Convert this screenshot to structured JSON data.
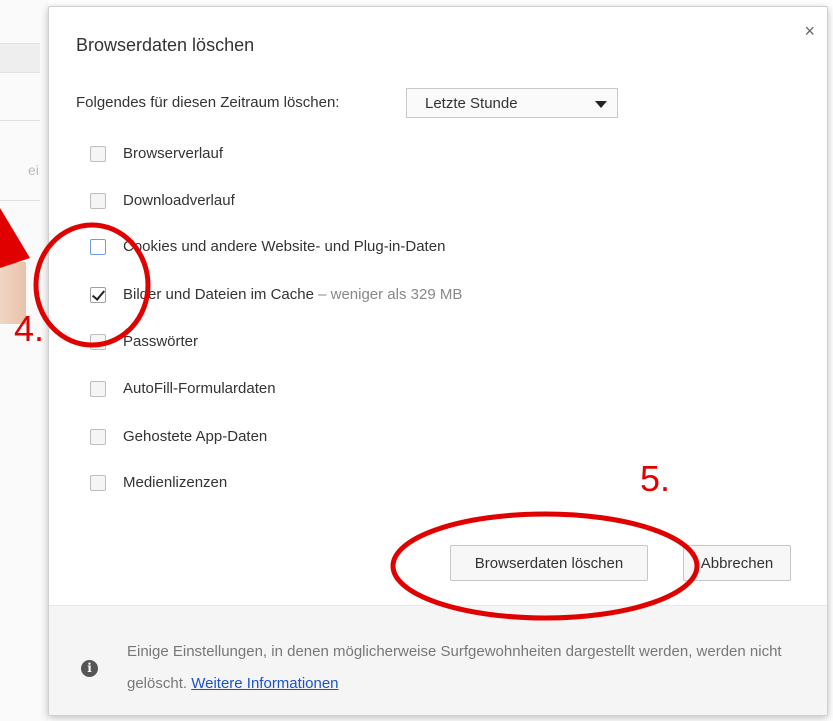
{
  "dialog": {
    "title": "Browserdaten löschen",
    "close_icon": "close-icon",
    "close_glyph": "×"
  },
  "time_range": {
    "label": "Folgendes für diesen Zeitraum löschen:",
    "selected": "Letzte Stunde"
  },
  "options": [
    {
      "label": "Browserverlauf",
      "checked": false
    },
    {
      "label": "Downloadverlauf",
      "checked": false
    },
    {
      "label": "Cookies und andere Website- und Plug-in-Daten",
      "checked": false
    },
    {
      "label": "Bilder und Dateien im Cache",
      "extra": " –  weniger als 329 MB",
      "checked": true
    },
    {
      "label": "Passwörter",
      "checked": false
    },
    {
      "label": "AutoFill-Formulardaten",
      "checked": false
    },
    {
      "label": "Gehostete App-Daten",
      "checked": false
    },
    {
      "label": "Medienlizenzen",
      "checked": false
    }
  ],
  "buttons": {
    "clear": "Browserdaten löschen",
    "cancel": "Abbrechen"
  },
  "footer": {
    "info_icon": "info-icon",
    "info_glyph": "i",
    "text": "Einige Einstellungen, in denen möglicherweise Surfgewohnheiten dargestellt werden, werden nicht gelöscht. ",
    "link": "Weitere Informationen"
  },
  "annotations": {
    "step4": "4.",
    "step5": "5.",
    "color": "#e10000"
  },
  "background": {
    "fragment_text": "ei"
  }
}
